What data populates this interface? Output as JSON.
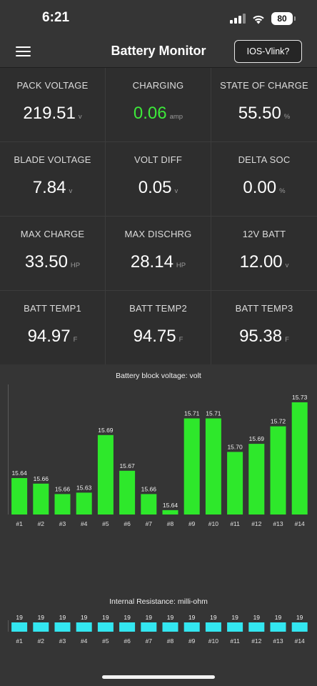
{
  "status_bar": {
    "time": "6:21",
    "battery": "80",
    "icons": [
      "signal-icon",
      "wifi-icon",
      "battery-icon"
    ]
  },
  "navbar": {
    "title": "Battery Monitor",
    "link_button": "IOS-Vlink?",
    "menu_icon": "hamburger-menu-icon"
  },
  "colors": {
    "background": "#353535",
    "tile": "#2e2e2e",
    "green_value": "#3de83a",
    "voltage_bar": "#2ee82b",
    "resistance_bar": "#33e6f0"
  },
  "metrics": [
    {
      "label": "PACK VOLTAGE",
      "value": "219.51",
      "unit": "v"
    },
    {
      "label": "CHARGING",
      "value": "0.06",
      "unit": "amp",
      "highlight": true
    },
    {
      "label": "STATE OF CHARGE",
      "value": "55.50",
      "unit": "%"
    },
    {
      "label": "BLADE VOLTAGE",
      "value": "7.84",
      "unit": "v"
    },
    {
      "label": "VOLT DIFF",
      "value": "0.05",
      "unit": "v"
    },
    {
      "label": "DELTA SOC",
      "value": "0.00",
      "unit": "%"
    },
    {
      "label": "MAX CHARGE",
      "value": "33.50",
      "unit": "HP"
    },
    {
      "label": "MAX DISCHRG",
      "value": "28.14",
      "unit": "HP"
    },
    {
      "label": "12V BATT",
      "value": "12.00",
      "unit": "v"
    },
    {
      "label": "BATT TEMP1",
      "value": "94.97",
      "unit": "F"
    },
    {
      "label": "BATT TEMP2",
      "value": "94.75",
      "unit": "F"
    },
    {
      "label": "BATT TEMP3",
      "value": "95.38",
      "unit": "F"
    }
  ],
  "chart_data": [
    {
      "type": "bar",
      "title": "Battery block voltage: volt",
      "categories": [
        "#1",
        "#2",
        "#3",
        "#4",
        "#5",
        "#6",
        "#7",
        "#8",
        "#9",
        "#10",
        "#11",
        "#12",
        "#13",
        "#14"
      ],
      "values": [
        15.64,
        15.66,
        15.66,
        15.63,
        15.69,
        15.67,
        15.66,
        15.64,
        15.71,
        15.71,
        15.7,
        15.69,
        15.72,
        15.73
      ],
      "bar_heights_relative": [
        0.325,
        0.275,
        0.182,
        0.195,
        0.708,
        0.39,
        0.182,
        0.039,
        0.857,
        0.857,
        0.558,
        0.63,
        0.786,
        1.0
      ],
      "grid": false,
      "legend": "none"
    },
    {
      "type": "bar",
      "title": "Internal Resistance: milli-ohm",
      "categories": [
        "#1",
        "#2",
        "#3",
        "#4",
        "#5",
        "#6",
        "#7",
        "#8",
        "#9",
        "#10",
        "#11",
        "#12",
        "#13",
        "#14"
      ],
      "values": [
        19,
        19,
        19,
        19,
        19,
        19,
        19,
        19,
        19,
        19,
        19,
        19,
        19,
        19
      ],
      "bar_heights_relative": [
        1,
        1,
        1,
        1,
        1,
        1,
        1,
        1,
        1,
        1,
        1,
        1,
        1,
        1
      ],
      "grid": false,
      "legend": "none"
    }
  ]
}
